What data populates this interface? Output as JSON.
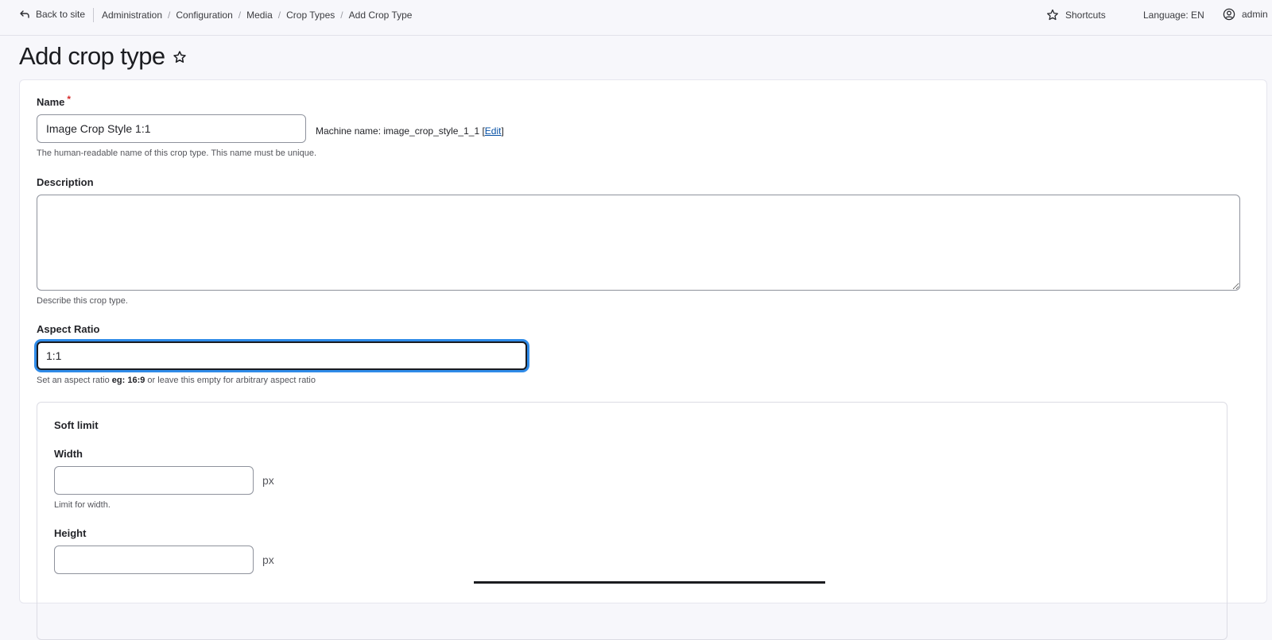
{
  "topbar": {
    "back_label": "Back to site",
    "breadcrumb": [
      "Administration",
      "Configuration",
      "Media",
      "Crop Types",
      "Add Crop Type"
    ],
    "shortcuts_label": "Shortcuts",
    "language_label": "Language: EN",
    "user_label": "admin"
  },
  "page": {
    "title": "Add crop type"
  },
  "form": {
    "name": {
      "label": "Name",
      "required_mark": "*",
      "value": "Image Crop Style 1:1",
      "machine_prefix": "Machine name: image_crop_style_1_1 [",
      "machine_edit": "Edit",
      "machine_suffix": "]",
      "help": "The human-readable name of this crop type. This name must be unique."
    },
    "description": {
      "label": "Description",
      "value": "",
      "help": "Describe this crop type."
    },
    "aspect_ratio": {
      "label": "Aspect Ratio",
      "value": "1:1",
      "help_prefix": "Set an aspect ratio ",
      "help_bold": "eg: 16:9",
      "help_suffix": " or leave this empty for arbitrary aspect ratio"
    },
    "soft_limit": {
      "legend": "Soft limit",
      "width_label": "Width",
      "width_value": "",
      "width_unit": "px",
      "width_help": "Limit for width.",
      "height_label": "Height",
      "height_value": "",
      "height_unit": "px"
    }
  },
  "colors": {
    "focus_ring": "#2f8be8",
    "link": "#0550a5",
    "required": "#d62d2d"
  }
}
